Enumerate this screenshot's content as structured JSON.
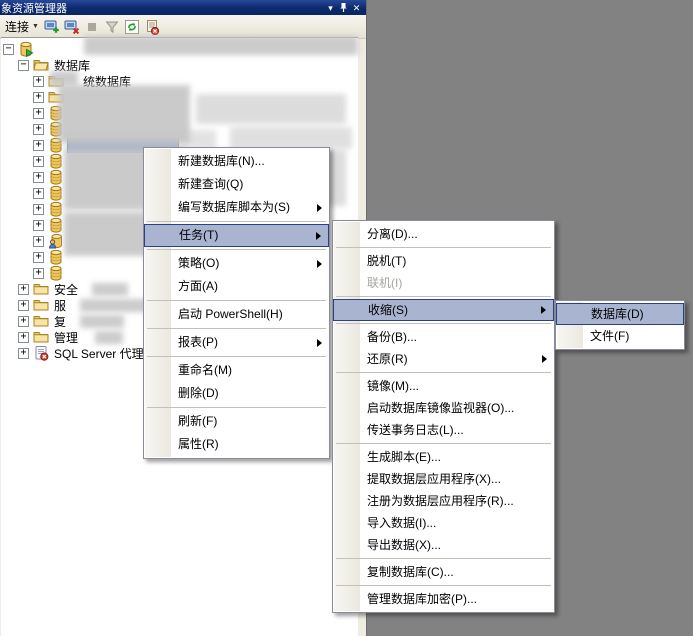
{
  "panel": {
    "title": "象资源管理器",
    "window_controls": {
      "position_icon": "▾",
      "close_icon": "✕"
    },
    "toolbar": {
      "connect_label": "连接",
      "icons": [
        "connect-server-icon",
        "disconnect-server-icon",
        "stop-icon",
        "filter-icon",
        "refresh-icon",
        "script-error-icon"
      ]
    }
  },
  "tree": {
    "items": [
      {
        "level": 0,
        "box": "minus",
        "icon": "server",
        "label": "",
        "redacted": true
      },
      {
        "level": 1,
        "box": "minus",
        "icon": "folder-open",
        "label": "数据库"
      },
      {
        "level": 2,
        "box": "plus",
        "icon": "folder",
        "label": "统数据库",
        "labelOffset": 14
      },
      {
        "level": 2,
        "box": "plus",
        "icon": "folder",
        "label": "",
        "redacted": true
      },
      {
        "level": 2,
        "box": "plus",
        "icon": "database",
        "label": "",
        "redacted": true
      },
      {
        "level": 2,
        "box": "plus",
        "icon": "database",
        "label": "",
        "redacted": true
      },
      {
        "level": 2,
        "box": "plus",
        "icon": "database",
        "label": "",
        "redacted": true,
        "selected": true
      },
      {
        "level": 2,
        "box": "plus",
        "icon": "database",
        "label": "",
        "redacted": true
      },
      {
        "level": 2,
        "box": "plus",
        "icon": "database",
        "label": "",
        "redacted": true
      },
      {
        "level": 2,
        "box": "plus",
        "icon": "database",
        "label": "",
        "redacted": true
      },
      {
        "level": 2,
        "box": "plus",
        "icon": "database",
        "label": "",
        "redacted": true
      },
      {
        "level": 2,
        "box": "plus",
        "icon": "database",
        "label": "",
        "redacted": true
      },
      {
        "level": 2,
        "box": "plus",
        "icon": "database-user",
        "label": "",
        "redacted": true
      },
      {
        "level": 2,
        "box": "plus",
        "icon": "database",
        "label": "",
        "redacted": true
      },
      {
        "level": 2,
        "box": "plus",
        "icon": "database",
        "label": "",
        "redacted": true
      },
      {
        "level": 1,
        "box": "plus",
        "icon": "folder",
        "label": "安全"
      },
      {
        "level": 1,
        "box": "plus",
        "icon": "folder",
        "label": "服"
      },
      {
        "level": 1,
        "box": "plus",
        "icon": "folder",
        "label": "复"
      },
      {
        "level": 1,
        "box": "plus",
        "icon": "folder",
        "label": "管理"
      },
      {
        "level": 1,
        "box": "plus",
        "icon": "sql-agent",
        "label": "SQL Server 代理"
      }
    ]
  },
  "menus": {
    "context": {
      "items": [
        {
          "label": "新建数据库(N)..."
        },
        {
          "label": "新建查询(Q)"
        },
        {
          "label": "编写数据库脚本为(S)",
          "submenu": true
        },
        {
          "sep": true
        },
        {
          "label": "任务(T)",
          "submenu": true,
          "highlight": true
        },
        {
          "sep": true
        },
        {
          "label": "策略(O)",
          "submenu": true
        },
        {
          "label": "方面(A)"
        },
        {
          "sep": true
        },
        {
          "label": "启动 PowerShell(H)"
        },
        {
          "sep": true
        },
        {
          "label": "报表(P)",
          "submenu": true
        },
        {
          "sep": true
        },
        {
          "label": "重命名(M)"
        },
        {
          "label": "删除(D)"
        },
        {
          "sep": true
        },
        {
          "label": "刷新(F)"
        },
        {
          "label": "属性(R)"
        }
      ]
    },
    "tasks": {
      "items": [
        {
          "label": "分离(D)..."
        },
        {
          "sep": true
        },
        {
          "label": "脱机(T)"
        },
        {
          "label": "联机(I)",
          "disabled": true
        },
        {
          "sep": true
        },
        {
          "label": "收缩(S)",
          "submenu": true,
          "highlight": true
        },
        {
          "sep": true
        },
        {
          "label": "备份(B)..."
        },
        {
          "label": "还原(R)",
          "submenu": true
        },
        {
          "sep": true
        },
        {
          "label": "镜像(M)..."
        },
        {
          "label": "启动数据库镜像监视器(O)..."
        },
        {
          "label": "传送事务日志(L)..."
        },
        {
          "sep": true
        },
        {
          "label": "生成脚本(E)..."
        },
        {
          "label": "提取数据层应用程序(X)..."
        },
        {
          "label": "注册为数据层应用程序(R)..."
        },
        {
          "label": "导入数据(I)..."
        },
        {
          "label": "导出数据(X)..."
        },
        {
          "sep": true
        },
        {
          "label": "复制数据库(C)..."
        },
        {
          "sep": true
        },
        {
          "label": "管理数据库加密(P)..."
        }
      ]
    },
    "shrink": {
      "items": [
        {
          "label": "数据库(D)",
          "highlight": true
        },
        {
          "label": "文件(F)"
        }
      ]
    }
  },
  "colors": {
    "titlebar": "#0b2a6d",
    "panel_background": "#efece1",
    "menu_highlight_fill": "#a9b4d1",
    "menu_highlight_border": "#2c417f",
    "tree_selection": "#91a4c7",
    "window_background": "#828282"
  }
}
